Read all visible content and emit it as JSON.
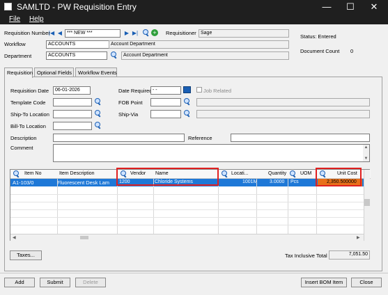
{
  "window": {
    "title": "SAMLTD - PW Requisition Entry",
    "minimize": "—",
    "maximize": "☐",
    "close": "✕"
  },
  "menu": {
    "file": "File",
    "help": "Help"
  },
  "header": {
    "requisition_number_label": "Requisition Number",
    "requisition_number_value": "*** NEW ***",
    "requisitioner_label": "Requisitioner",
    "requisitioner_value": "Sage",
    "workflow_label": "Workflow",
    "workflow_value": "ACCOUNTS",
    "workflow_desc": "Account Department",
    "department_label": "Department",
    "department_value": "ACCOUNTS",
    "department_desc": "Account Department",
    "status_text": "Status: Entered",
    "doc_count_label": "Document Count",
    "doc_count_value": "0"
  },
  "tabs": [
    {
      "label": "Requisition"
    },
    {
      "label": "Optional Fields"
    },
    {
      "label": "Workflow Events"
    }
  ],
  "form": {
    "req_date_label": "Requisition Date",
    "req_date_value": "06-01-2026",
    "date_required_label": "Date Required",
    "date_required_value": "- -",
    "job_related_label": "Job Related",
    "template_code_label": "Template Code",
    "fob_point_label": "FOB Point",
    "ship_to_label": "Ship-To Location",
    "ship_via_label": "Ship-Via",
    "bill_to_label": "Bill-To Location",
    "description_label": "Description",
    "reference_label": "Reference",
    "comment_label": "Comment"
  },
  "grid": {
    "headers": [
      "Item No",
      "Item Description",
      "Vendor",
      "Name",
      "Locati...",
      "Quantity",
      "UOM",
      "Unit Cost"
    ],
    "rows": [
      {
        "item_no": "A1-103/0",
        "description": "Fluorescent Desk Lam",
        "vendor": "1200",
        "name": "Chloride Systems",
        "location": "1001M",
        "quantity": "3.0000",
        "uom": "Pcs",
        "unit_cost": "2,350.500000"
      }
    ]
  },
  "footer": {
    "taxes_button": "Taxes...",
    "tax_total_label": "Tax Inclusive Total",
    "tax_total_value": "7,051.50",
    "add_button": "Add",
    "submit_button": "Submit",
    "delete_button": "Delete",
    "insert_bom_button": "Insert BOM Item",
    "close_button": "Close"
  }
}
